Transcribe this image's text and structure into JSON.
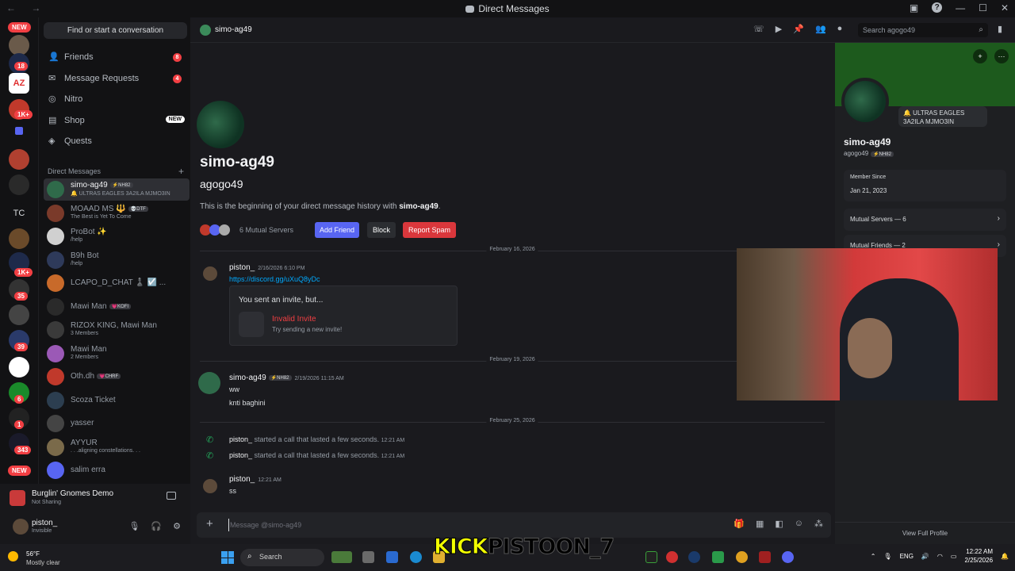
{
  "window": {
    "title": "Direct Messages",
    "nav": "← →"
  },
  "guild_rail": {
    "new_top": "NEW",
    "new_bottom": "NEW",
    "badges": [
      "18",
      "1K+",
      "1K+",
      "35",
      "39",
      "6",
      "1",
      "343"
    ],
    "labels": [
      "AZ",
      "TC"
    ]
  },
  "sidebar": {
    "search_label": "Find or start a conversation",
    "nav": [
      {
        "label": "Friends",
        "count": "8",
        "icon": "friends-icon"
      },
      {
        "label": "Message Requests",
        "count": "4",
        "icon": "mail-icon"
      },
      {
        "label": "Nitro",
        "icon": "nitro-icon"
      },
      {
        "label": "Shop",
        "badge": "NEW",
        "icon": "shop-icon"
      },
      {
        "label": "Quests",
        "icon": "quests-icon"
      }
    ],
    "dm_header": "Direct Messages",
    "dms": [
      {
        "name": "simo-ag49",
        "tag": "⚡NH82",
        "sub": "🔔 ULTRAS EAGLES 3A2ILA MJMO3IN",
        "color": "#2f6a4a",
        "active": true
      },
      {
        "name": "MOAAD MS 🔱",
        "tag": "💀DTF",
        "sub": "The Best is Yet To Come",
        "color": "#7a3a2a"
      },
      {
        "name": "ProBot ✨",
        "sub": "/help",
        "color": "#d0d0d0"
      },
      {
        "name": "B9h Bot",
        "sub": "/help",
        "color": "#2e3a5a"
      },
      {
        "name": "LCAPO_D_CHAT ♟️ ☑️ ...",
        "sub": "",
        "color": "#c86a2a"
      },
      {
        "name": "Mawi Man",
        "tag": "💗KOFI",
        "sub": "",
        "color": "#2a2a2a"
      },
      {
        "name": "RIZOX KING, Mawi Man",
        "sub": "3 Members",
        "color": "#3a3a3a"
      },
      {
        "name": "Mawi Man",
        "sub": "2 Members",
        "color": "#9b59b6"
      },
      {
        "name": "Oth.dh",
        "tag": "💗CHRF",
        "sub": "",
        "color": "#c0392b"
      },
      {
        "name": "Scoza Ticket",
        "sub": "",
        "color": "#2c3e50"
      },
      {
        "name": "yasser",
        "sub": "",
        "color": "#444"
      },
      {
        "name": "AYYUR",
        "sub": ". . .aligning constellations. . .",
        "color": "#7a6a4a"
      },
      {
        "name": "salim erra",
        "sub": "",
        "color": "#5865f2"
      }
    ]
  },
  "activity": {
    "game": "Burglin' Gnomes Demo",
    "status": "Not Sharing"
  },
  "user": {
    "name": "piston_",
    "status": "Invisible"
  },
  "header": {
    "name": "simo-ag49",
    "search_placeholder": "Search agogo49"
  },
  "intro": {
    "display_name": "simo-ag49",
    "username": "agogo49",
    "text_prefix": "This is the beginning of your direct message history with ",
    "text_name": "simo-ag49",
    "text_suffix": ".",
    "mutual_servers": "6 Mutual Servers",
    "add_friend": "Add Friend",
    "block": "Block",
    "report_spam": "Report Spam"
  },
  "messages": {
    "date1": "February 16, 2026",
    "m1": {
      "author": "piston_",
      "time": "2/16/2026 6:10 PM",
      "link": "https://discord.gg/uXuQ8yDc"
    },
    "invite": {
      "heading": "You sent an invite, but...",
      "title": "Invalid Invite",
      "subtitle": "Try sending a new invite!"
    },
    "date2": "February 19, 2026",
    "m2": {
      "author": "simo-ag49",
      "tag": "⚡NH82",
      "time": "2/19/2026 11:15 AM",
      "line1": "ww",
      "line2": "knti baghini"
    },
    "date3": "February 25, 2026",
    "call1": {
      "author": "piston_",
      "text": " started a call that lasted a few seconds.",
      "time": "12:21 AM"
    },
    "call2": {
      "author": "piston_",
      "text": " started a call that lasted a few seconds.",
      "time": "12:21 AM"
    },
    "m3": {
      "author": "piston_",
      "time": "12:21 AM",
      "text": "ss"
    }
  },
  "composer": {
    "placeholder": "Message @simo-ag49"
  },
  "profile": {
    "status": "🔔 ULTRAS EAGLES 3A2ILA MJMO3IN",
    "display_name": "simo-ag49",
    "username": "agogo49",
    "tag": "⚡NH82",
    "member_since_label": "Member Since",
    "member_since": "Jan 21, 2023",
    "mutual_servers": "Mutual Servers — 6",
    "mutual_friends": "Mutual Friends — 2",
    "view_full": "View Full Profile"
  },
  "overlay": {
    "a": "KICK",
    "b": "PISTOON_7"
  },
  "taskbar": {
    "temp": "56°F",
    "weather": "Mostly clear",
    "search": "Search",
    "lang": "ENG",
    "time": "12:22 AM",
    "date": "2/25/2026"
  },
  "colors": {
    "accent": "#5865f2",
    "danger": "#da373c",
    "online": "#23a55a",
    "banner": "#1d5a1d"
  }
}
